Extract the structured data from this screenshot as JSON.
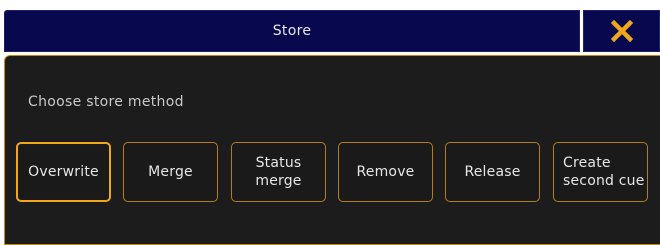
{
  "dialog": {
    "title": "Store",
    "close_icon": "close-x-icon",
    "accent_color": "#f0a818",
    "prompt": "Choose store method"
  },
  "methods": [
    {
      "label": "Overwrite",
      "selected": true
    },
    {
      "label": "Merge",
      "selected": false
    },
    {
      "label": "Status\nmerge",
      "selected": false
    },
    {
      "label": "Remove",
      "selected": false
    },
    {
      "label": "Release",
      "selected": false
    },
    {
      "label": "Create\nsecond cue",
      "selected": false
    }
  ]
}
